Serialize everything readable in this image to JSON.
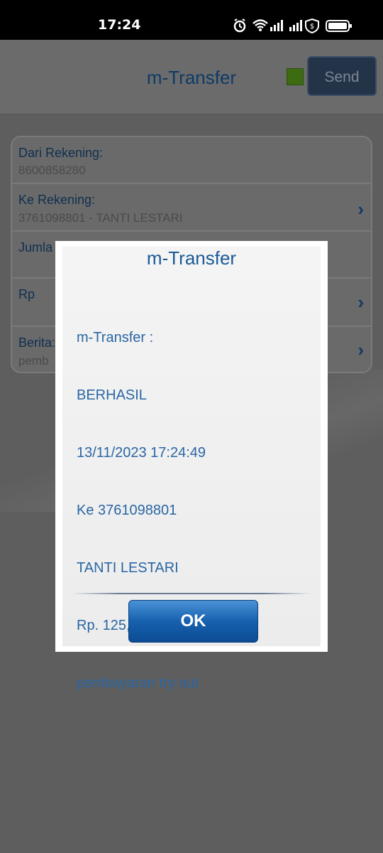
{
  "status_bar": {
    "time": "17:24",
    "icons": [
      "alarm-icon",
      "wifi-icon",
      "signal-icon",
      "signal-icon",
      "shield-icon",
      "battery-icon"
    ]
  },
  "header": {
    "title": "m-Transfer",
    "send_label": "Send",
    "indicator_color": "#3d6b12"
  },
  "form": {
    "from_label": "Dari Rekening:",
    "from_value": "8600858280",
    "to_label": "Ke Rekening:",
    "to_value": "3761098801 - TANTI LESTARI",
    "amount_label": "Jumla",
    "currency_label": "Rp",
    "message_label": "Berita:",
    "message_value": "pemb"
  },
  "dialog": {
    "title": "m-Transfer",
    "lines": [
      "m-Transfer :",
      "BERHASIL",
      "13/11/2023 17:24:49",
      "Ke 3761098801",
      "TANTI LESTARI",
      "Rp. 125,000.00",
      "pembayaran try out"
    ],
    "ok_label": "OK"
  },
  "colors": {
    "accent": "#1760ad",
    "title_blue": "#1a5a98",
    "overlay": "#5e5e5e"
  }
}
